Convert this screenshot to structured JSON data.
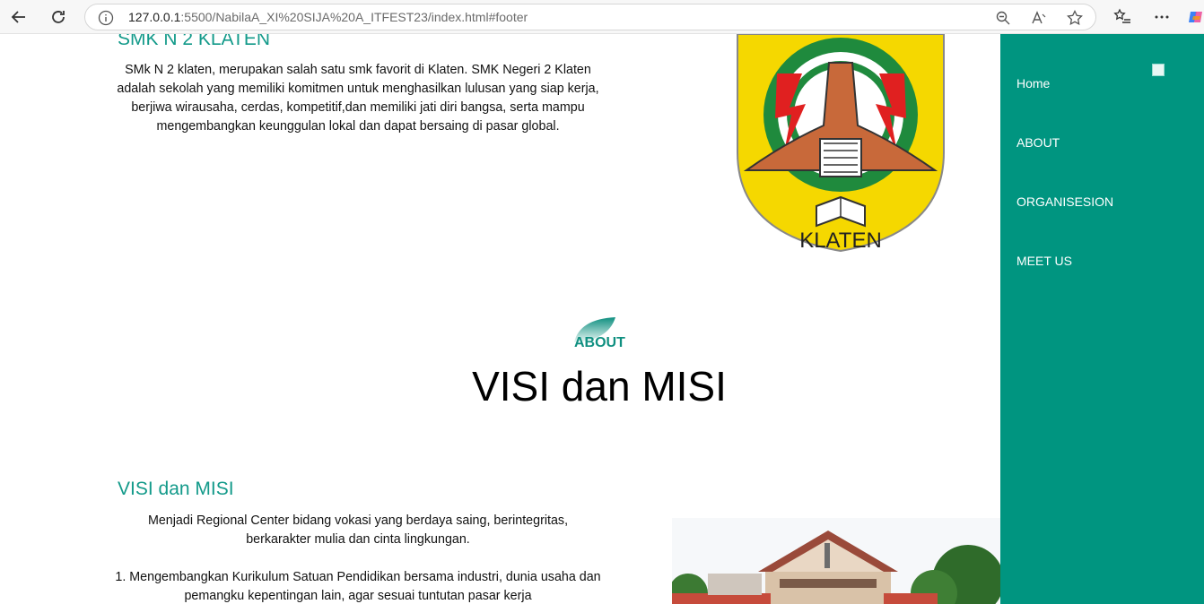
{
  "browser": {
    "url_host": "127.0.0.1",
    "url_rest": ":5500/NabilaA_XI%20SIJA%20A_ITFEST23/index.html#footer"
  },
  "sidebar": {
    "items": [
      {
        "label": "Home"
      },
      {
        "label": "ABOUT"
      },
      {
        "label": "ORGANISESION"
      },
      {
        "label": "MEET US"
      }
    ]
  },
  "school": {
    "title": "SMK N 2 KLATEN",
    "description": "SMk N 2 klaten, merupakan salah satu smk favorit di Klaten. SMK Negeri 2 Klaten adalah sekolah yang memiliki komitmen untuk menghasilkan lulusan yang siap kerja, berjiwa wirausaha, cerdas, kompetitif,dan memiliki jati diri bangsa, serta mampu mengembangkan keunggulan lokal dan dapat bersaing di pasar global.",
    "crest_text": "KLATEN"
  },
  "about": {
    "badge_label": "ABOUT",
    "heading": "VISI dan MISI"
  },
  "visi": {
    "title": "VISI dan MISI",
    "vision": "Menjadi Regional Center bidang vokasi yang berdaya saing, berintegritas, berkarakter mulia dan cinta lingkungan.",
    "mission_1": "1. Mengembangkan Kurikulum Satuan Pendidikan bersama industri, dunia usaha dan pemangku kepentingan lain, agar sesuai tuntutan pasar kerja"
  },
  "colors": {
    "teal": "#009580",
    "title_teal": "#139a8a"
  }
}
